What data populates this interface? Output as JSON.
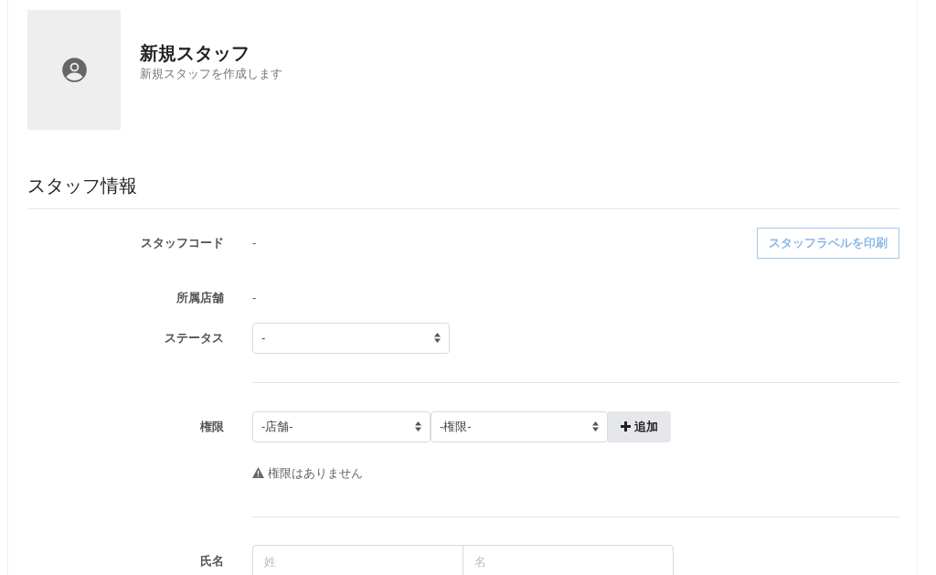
{
  "header": {
    "title": "新規スタッフ",
    "subtitle": "新規スタッフを作成します"
  },
  "section": {
    "title": "スタッフ情報",
    "print_button": "スタッフラベルを印刷"
  },
  "groups": [
    [
      {
        "kind": "text",
        "label": "スタッフコード",
        "value": "-"
      },
      {
        "kind": "text",
        "label": "所属店舗",
        "value": "-"
      },
      {
        "kind": "select",
        "label": "ステータス",
        "value": "-"
      }
    ],
    [
      {
        "kind": "permission",
        "label": "権限",
        "store_select": "-店舗-",
        "role_select": "-権限-",
        "add_button": "追加",
        "warning": "権限はありません"
      }
    ],
    [
      {
        "kind": "name",
        "label": "氏名",
        "placeholders": [
          "姓",
          "名"
        ]
      }
    ]
  ]
}
